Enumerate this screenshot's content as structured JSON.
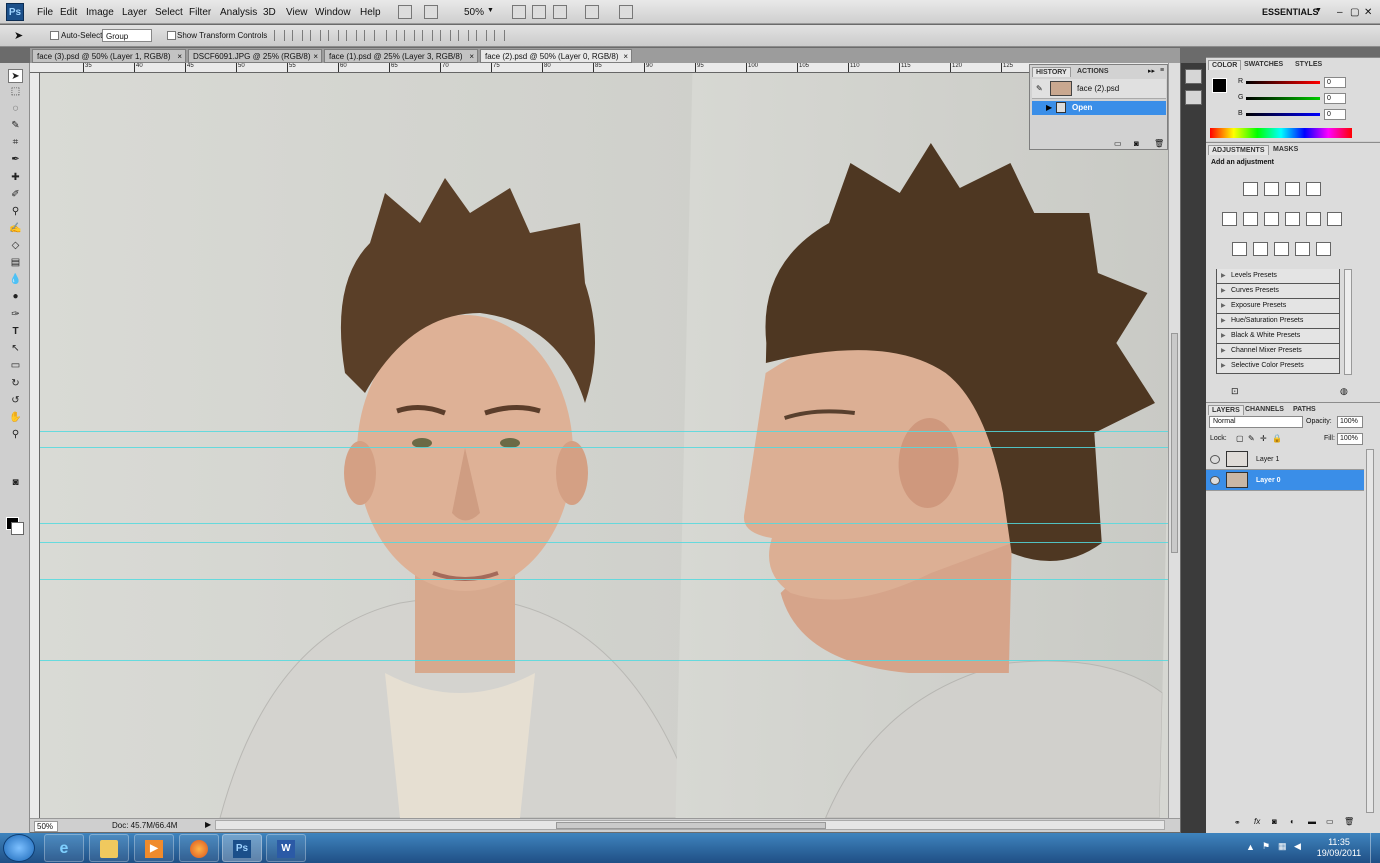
{
  "app": {
    "logo": "Ps"
  },
  "menubar": {
    "items": [
      "File",
      "Edit",
      "Image",
      "Layer",
      "Select",
      "Filter",
      "Analysis",
      "3D",
      "View",
      "Window",
      "Help"
    ],
    "zoom": "50%",
    "workspace": "ESSENTIALS"
  },
  "options": {
    "auto_select_label": "Auto-Select:",
    "auto_select_value": "Group",
    "show_transform_label": "Show Transform Controls"
  },
  "doc_tabs": [
    {
      "label": "face (3).psd @ 50% (Layer 1, RGB/8)"
    },
    {
      "label": "DSCF6091.JPG @ 25% (RGB/8)"
    },
    {
      "label": "face (1).psd @ 25% (Layer 3, RGB/8)"
    },
    {
      "label": "face (2).psd @ 50% (Layer 0, RGB/8)"
    }
  ],
  "ruler": {
    "ticks": [
      "35",
      "40",
      "45",
      "50",
      "55",
      "60",
      "65",
      "70",
      "75",
      "80",
      "85",
      "90",
      "95",
      "100",
      "105",
      "110",
      "115",
      "120",
      "125"
    ]
  },
  "status": {
    "zoom": "50%",
    "doc": "Doc: 45.7M/66.4M"
  },
  "history": {
    "tabs": [
      "HISTORY",
      "ACTIONS"
    ],
    "snapshot": "face (2).psd",
    "step": "Open"
  },
  "color_panel": {
    "tabs": [
      "COLOR",
      "SWATCHES",
      "STYLES"
    ],
    "channels": [
      {
        "name": "R",
        "value": "0",
        "color": "#d11"
      },
      {
        "name": "G",
        "value": "0",
        "color": "#1a1"
      },
      {
        "name": "B",
        "value": "0",
        "color": "#11c"
      }
    ]
  },
  "adjustments": {
    "tabs": [
      "ADJUSTMENTS",
      "MASKS"
    ],
    "heading": "Add an adjustment",
    "presets": [
      "Levels Presets",
      "Curves Presets",
      "Exposure Presets",
      "Hue/Saturation Presets",
      "Black & White Presets",
      "Channel Mixer Presets",
      "Selective Color Presets"
    ]
  },
  "layers": {
    "tabs": [
      "LAYERS",
      "CHANNELS",
      "PATHS"
    ],
    "blend_mode": "Normal",
    "opacity_label": "Opacity:",
    "opacity": "100%",
    "lock_label": "Lock:",
    "fill_label": "Fill:",
    "fill": "100%",
    "items": [
      {
        "name": "Layer 1",
        "selected": false
      },
      {
        "name": "Layer 0",
        "selected": true
      }
    ]
  },
  "taskbar": {
    "time": "11:35",
    "date": "19/09/2011"
  }
}
